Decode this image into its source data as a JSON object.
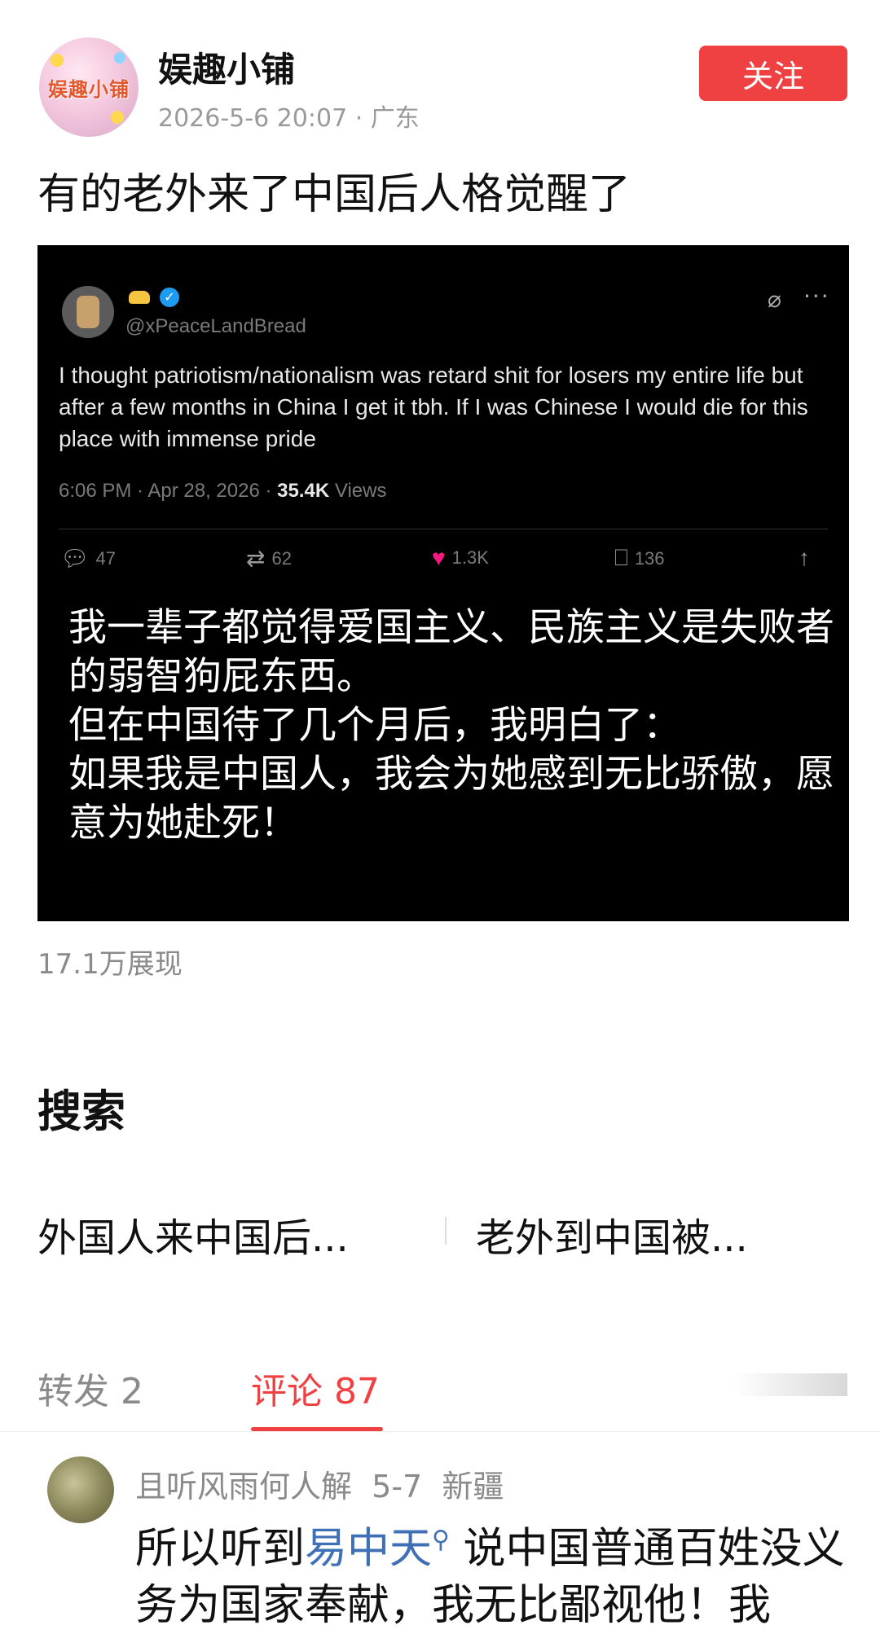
{
  "header": {
    "avatar_text": "娱趣小铺",
    "author": "娱趣小铺",
    "meta": "2026-5-6 20:07 · 广东",
    "follow_label": "关注"
  },
  "post": {
    "title": "有的老外来了中国后人格觉醒了",
    "views": "17.1万展现"
  },
  "tweet": {
    "handle": "@xPeaceLandBread",
    "text": "I thought patriotism/nationalism was retard shit for losers my entire life but after a few months in China I get it tbh. If I was Chinese I would die for this place with immense pride",
    "time": "6:06 PM · Apr 28, 2026 · ",
    "views_count": "35.4K",
    "views_label": " Views",
    "replies": "47",
    "retweets": "62",
    "likes": "1.3K",
    "bookmarks": "136",
    "translation": "我一辈子都觉得爱国主义、民族主义是失败者的弱智狗屁东西。\n但在中国待了几个月后，我明白了：\n如果我是中国人，我会为她感到无比骄傲，愿意为她赴死！"
  },
  "search": {
    "title": "搜索",
    "items": [
      "外国人来中国后...",
      "老外到中国被..."
    ]
  },
  "tabs": {
    "repost": "转发 2",
    "comments": "评论 87"
  },
  "comment": {
    "author": "且听风雨何人解  5-7  新疆",
    "text_before": "所以听到",
    "link": "易中天",
    "text_after": " 说中国普通百姓没义务为国家奉献，我无比鄙视他！我"
  },
  "colors": {
    "accent": "#f04142",
    "link": "#3f6fb5",
    "muted": "#8a8a8a"
  }
}
